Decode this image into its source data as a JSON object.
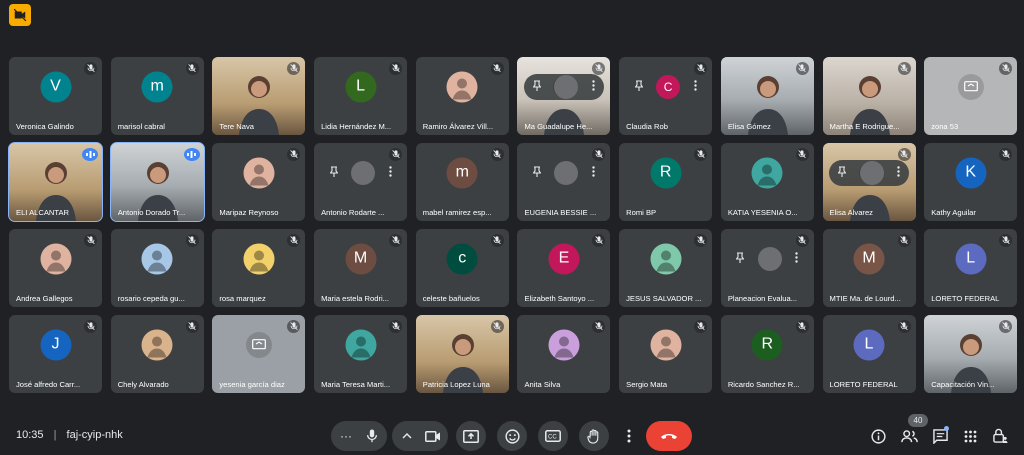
{
  "meeting": {
    "time": "10:35",
    "separator": "|",
    "code": "faj-cyip-nhk",
    "participant_count": "40"
  },
  "colors": {
    "background": "#202124",
    "tile": "#3c4043",
    "end_call": "#ea4335",
    "speaking": "#4285f4",
    "badge": "#f9ab00"
  },
  "tiles": [
    {
      "name": "Veronica Galindo",
      "initial": "V",
      "color": "#00838f",
      "kind": "avatar"
    },
    {
      "name": "marisol cabral",
      "initial": "m",
      "color": "#00838f",
      "kind": "avatar"
    },
    {
      "name": "Tere Nava",
      "kind": "photo"
    },
    {
      "name": "Lidia Hernández M...",
      "initial": "L",
      "color": "#33691e",
      "kind": "avatar"
    },
    {
      "name": "Ramiro Álvarez Vill...",
      "kind": "image"
    },
    {
      "name": "Ma Guadalupe He...",
      "kind": "photo-pin"
    },
    {
      "name": "Claudia Rob",
      "initial": "C",
      "color": "#c2185b",
      "kind": "pin"
    },
    {
      "name": "Elisa Gómez",
      "kind": "photo"
    },
    {
      "name": "Martha E Rodrigue...",
      "kind": "photo"
    },
    {
      "name": "zona 53",
      "kind": "screen"
    },
    {
      "name": "ELI ALCANTAR",
      "kind": "photo-speaking"
    },
    {
      "name": "Antonio Dorado Tr...",
      "kind": "photo-speaking"
    },
    {
      "name": "Maripaz Reynoso",
      "kind": "image"
    },
    {
      "name": "Antonio Rodarte ...",
      "kind": "pin-image"
    },
    {
      "name": "mabel ramirez esp...",
      "initial": "m",
      "color": "#6d4c41",
      "kind": "avatar"
    },
    {
      "name": "EUGENIA BESSIE ...",
      "kind": "pin-image"
    },
    {
      "name": "Romi BP",
      "initial": "R",
      "color": "#00796b",
      "kind": "avatar"
    },
    {
      "name": "KATIA YESENIA O...",
      "kind": "image"
    },
    {
      "name": "Elisa Alvarez",
      "kind": "photo-pin"
    },
    {
      "name": "Kathy Aguilar",
      "initial": "K",
      "color": "#1565c0",
      "kind": "avatar"
    },
    {
      "name": "Andrea Gallegos",
      "kind": "image"
    },
    {
      "name": "rosario cepeda gu...",
      "kind": "image"
    },
    {
      "name": "rosa marquez",
      "kind": "image"
    },
    {
      "name": "Maria estela Rodri...",
      "initial": "M",
      "color": "#6d4c41",
      "kind": "avatar"
    },
    {
      "name": "celeste bañuelos",
      "initial": "c",
      "color": "#004d40",
      "kind": "avatar"
    },
    {
      "name": "Elizabeth Santoyo ...",
      "initial": "E",
      "color": "#c2185b",
      "kind": "avatar"
    },
    {
      "name": "JESUS SALVADOR ...",
      "kind": "image"
    },
    {
      "name": "Planeacion Evalua...",
      "kind": "pin-image"
    },
    {
      "name": "MTIE Ma. de Lourd...",
      "initial": "M",
      "color": "#795548",
      "kind": "avatar"
    },
    {
      "name": "LORETO FEDERAL",
      "initial": "L",
      "color": "#5c6bc0",
      "kind": "avatar"
    },
    {
      "name": "José alfredo Carr...",
      "initial": "J",
      "color": "#1565c0",
      "kind": "avatar"
    },
    {
      "name": "Chely Alvarado",
      "kind": "image"
    },
    {
      "name": "yesenia garcía diaz",
      "kind": "screen"
    },
    {
      "name": "Maria Teresa Marti...",
      "kind": "image"
    },
    {
      "name": "Patricia Lopez Luna",
      "kind": "photo"
    },
    {
      "name": "Anita Silva",
      "kind": "image"
    },
    {
      "name": "Sergio Mata",
      "kind": "image"
    },
    {
      "name": "Ricardo Sanchez R...",
      "initial": "R",
      "color": "#1b5e20",
      "kind": "avatar"
    },
    {
      "name": "LORETO FEDERAL",
      "initial": "L",
      "color": "#5c6bc0",
      "kind": "avatar"
    },
    {
      "name": "Capacitación Vin...",
      "kind": "photo"
    }
  ],
  "controls": [
    {
      "name": "more-options-left-button",
      "icon": "more-horizontal-icon"
    },
    {
      "name": "mic-button",
      "icon": "mic-icon"
    },
    {
      "name": "camera-options-button",
      "icon": "chevron-up-icon"
    },
    {
      "name": "camera-button",
      "icon": "camera-icon"
    },
    {
      "name": "present-button",
      "icon": "present-icon"
    },
    {
      "name": "emoji-button",
      "icon": "emoji-icon"
    },
    {
      "name": "captions-button",
      "icon": "captions-icon"
    },
    {
      "name": "raise-hand-button",
      "icon": "hand-icon"
    },
    {
      "name": "more-options-button",
      "icon": "more-vertical-icon"
    },
    {
      "name": "end-call-button",
      "icon": "phone-hangup-icon"
    }
  ]
}
